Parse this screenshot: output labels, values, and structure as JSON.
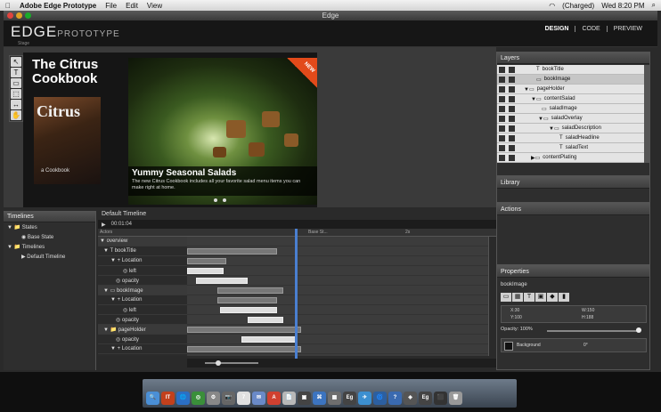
{
  "menubar": {
    "apple": "",
    "app": "Adobe Edge Prototype",
    "items": [
      "File",
      "Edit",
      "View"
    ],
    "status": "(Charged)",
    "clock": "Wed 8:20 PM"
  },
  "window": {
    "title": "Edge"
  },
  "header": {
    "logo_main": "EDGE",
    "logo_sub": "PROTOTYPE",
    "stage_label": "Stage",
    "modes": [
      "DESIGN",
      "CODE",
      "PREVIEW"
    ]
  },
  "tools": [
    "↖",
    "T",
    "▭",
    "⬚",
    "↔",
    "✋"
  ],
  "stage": {
    "title": "The Citrus Cookbook",
    "cover_title": "Citrus",
    "cover_sub": "a Cookbook",
    "badge": "NEW",
    "headline": "Yummy Seasonal Salads",
    "text": "The new Citrus Cookbook includes all your favorite salad menu items you can make right at home."
  },
  "layers": {
    "title": "Layers",
    "rows": [
      {
        "name": "bookTitle",
        "indent": 44,
        "icon": "T",
        "selected": false
      },
      {
        "name": "bookImage",
        "indent": 44,
        "icon": "▭",
        "selected": true
      },
      {
        "name": "pageHolder",
        "indent": 30,
        "icon": "▼▭",
        "selected": false
      },
      {
        "name": "contentSalad",
        "indent": 38,
        "icon": "▼▭",
        "selected": false
      },
      {
        "name": "saladImage",
        "indent": 50,
        "icon": "▭",
        "selected": false
      },
      {
        "name": "saladOverlay",
        "indent": 46,
        "icon": "▼▭",
        "selected": false
      },
      {
        "name": "saladDescription",
        "indent": 58,
        "icon": "▼▭",
        "selected": false
      },
      {
        "name": "saladHeadline",
        "indent": 70,
        "icon": "T",
        "selected": false
      },
      {
        "name": "saladText",
        "indent": 70,
        "icon": "T",
        "selected": false
      },
      {
        "name": "contentPlating",
        "indent": 38,
        "icon": "▶▭",
        "selected": false
      }
    ]
  },
  "library": {
    "title": "Library"
  },
  "actions": {
    "title": "Actions"
  },
  "properties": {
    "title": "Properties",
    "element": "bookImage",
    "x": "X:30",
    "y": "Y:100",
    "w": "W:150",
    "h": "H:188",
    "opacity": "Opacity: 100%",
    "background": "Background",
    "rotation": "0°"
  },
  "timelines": {
    "title": "Timelines",
    "tree": [
      {
        "label": "▼ 📁 States",
        "indent": 4
      },
      {
        "label": "◉ Base State",
        "indent": 20
      },
      {
        "label": "▼ 📁 Timelines",
        "indent": 4
      },
      {
        "label": "▶ Default Timeline",
        "indent": 20
      }
    ]
  },
  "timeline": {
    "title": "Default Timeline",
    "time": "00:01:04",
    "actors_label": "Actors",
    "base_state": "Base St...",
    "ruler_mark": "2s",
    "rows": [
      {
        "label": "▼ overview",
        "indent": 2,
        "group": true,
        "bars": []
      },
      {
        "label": "▼ T bookTitle",
        "indent": 6,
        "group": false,
        "bars": [
          {
            "s": 0,
            "e": 0.3,
            "light": false
          }
        ]
      },
      {
        "label": "▼ + Location",
        "indent": 14,
        "group": false,
        "bars": [
          {
            "s": 0,
            "e": 0.13,
            "light": false
          }
        ]
      },
      {
        "label": "◎ left",
        "indent": 28,
        "group": false,
        "bars": [
          {
            "s": 0,
            "e": 0.12,
            "light": true
          }
        ]
      },
      {
        "label": "◎ opacity",
        "indent": 20,
        "group": false,
        "bars": [
          {
            "s": 0.03,
            "e": 0.2,
            "light": true
          }
        ]
      },
      {
        "label": "▼ ▭ bookImage",
        "indent": 6,
        "group": true,
        "bars": [
          {
            "s": 0.1,
            "e": 0.32,
            "light": false
          }
        ]
      },
      {
        "label": "▼ + Location",
        "indent": 14,
        "group": false,
        "bars": [
          {
            "s": 0.1,
            "e": 0.3,
            "light": false
          }
        ]
      },
      {
        "label": "◎ left",
        "indent": 28,
        "group": false,
        "bars": [
          {
            "s": 0.11,
            "e": 0.3,
            "light": true
          }
        ]
      },
      {
        "label": "◎ opacity",
        "indent": 20,
        "group": false,
        "bars": [
          {
            "s": 0.2,
            "e": 0.32,
            "light": true
          }
        ]
      },
      {
        "label": "▼ 📁 pageHolder",
        "indent": 6,
        "group": true,
        "bars": [
          {
            "s": 0,
            "e": 0.38,
            "light": false
          }
        ]
      },
      {
        "label": "◎ opacity",
        "indent": 20,
        "group": false,
        "bars": [
          {
            "s": 0.18,
            "e": 0.36,
            "light": true
          }
        ]
      },
      {
        "label": "▼ + Location",
        "indent": 14,
        "group": false,
        "bars": [
          {
            "s": 0,
            "e": 0.38,
            "light": false
          }
        ]
      }
    ]
  },
  "dock": {
    "icons": [
      "🔍",
      "IT",
      "🌐",
      "◎",
      "⚙",
      "📷",
      "7",
      "✉",
      "A",
      "📄",
      "▣",
      "⌘",
      "▦",
      "Eg",
      "✈",
      "🌀",
      "?",
      "◈",
      "Eg",
      "⬛",
      "🗑"
    ]
  }
}
